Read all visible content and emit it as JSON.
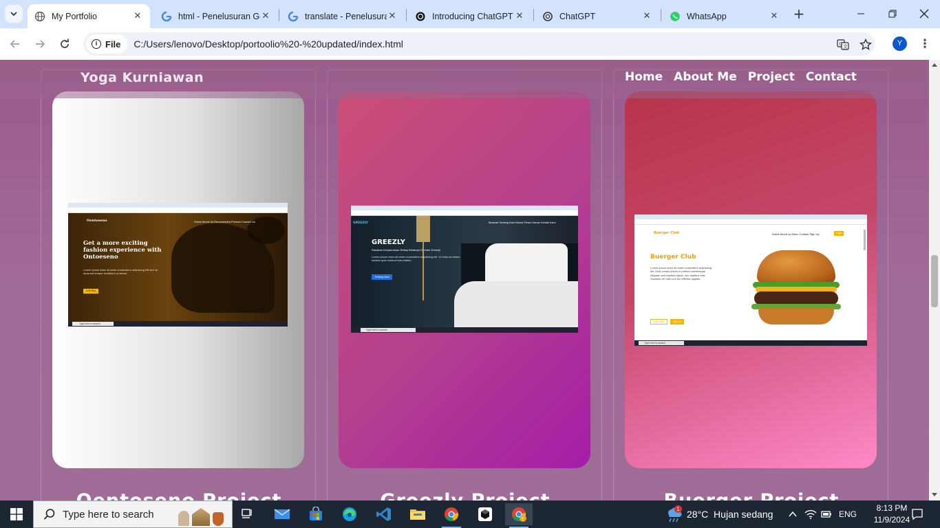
{
  "browser": {
    "tabs": [
      {
        "title": "My Portfolio",
        "icon": "globe-icon",
        "active": true
      },
      {
        "title": "html - Penelusuran Go",
        "icon": "google-icon",
        "active": false
      },
      {
        "title": "translate - Penelusura",
        "icon": "google-icon",
        "active": false
      },
      {
        "title": "Introducing ChatGPT",
        "icon": "openai-icon",
        "active": false
      },
      {
        "title": "ChatGPT",
        "icon": "openai-icon",
        "active": false
      },
      {
        "title": "WhatsApp",
        "icon": "whatsapp-icon",
        "active": false
      }
    ],
    "address": {
      "chip_label": "File",
      "url": "C:/Users/lenovo/Desktop/portoolio%20-%20updated/index.html"
    },
    "profile_initial": "Y"
  },
  "site": {
    "brand": "Yoga Kurniawan",
    "nav": [
      "Home",
      "About Me",
      "Project",
      "Contact"
    ],
    "projects": [
      {
        "title": "Oentoseno Project",
        "screenshot": {
          "logo": "Oentoseno",
          "nav": "Home  About Us  Recomended  Product  Contact Us",
          "headline": "Get a more exciting fashion experience with Ontoeseno",
          "button": "Let's Buy",
          "taskbar_search": "Type here to search"
        }
      },
      {
        "title": "Greezly Project",
        "screenshot": {
          "logo": "GREEZLY",
          "nav": "Beranda  Tentang Kami  Kamar  Pesan Kamar  Kontak Kami",
          "headline": "GREEZLY",
          "subheadline": "Rasakan Kenyamanan Setiap Bedanya Di Hotel Greezly",
          "button": "Tentang Kami",
          "taskbar_search": "Type here to search"
        }
      },
      {
        "title": "Buerger Project",
        "screenshot": {
          "logo": "Buerger Club",
          "nav": "Home  About us  Menu  Contact  Sign Up",
          "login": "Login",
          "headline": "Buerger Club",
          "buttons": [
            "Learn More",
            "Sign Up"
          ],
          "taskbar_search": "Type here to search"
        }
      }
    ]
  },
  "taskbar": {
    "search_placeholder": "Type here to search",
    "weather": "28°C  Hujan sedang",
    "weather_badge": "1",
    "language": "ENG",
    "time": "8:13 PM",
    "date": "11/9/2024"
  },
  "colors": {
    "page_bg": "#9a5e8b",
    "tabstrip": "#d3e3fd",
    "taskbar": "#1c2733",
    "accent": "#0b57d0"
  }
}
